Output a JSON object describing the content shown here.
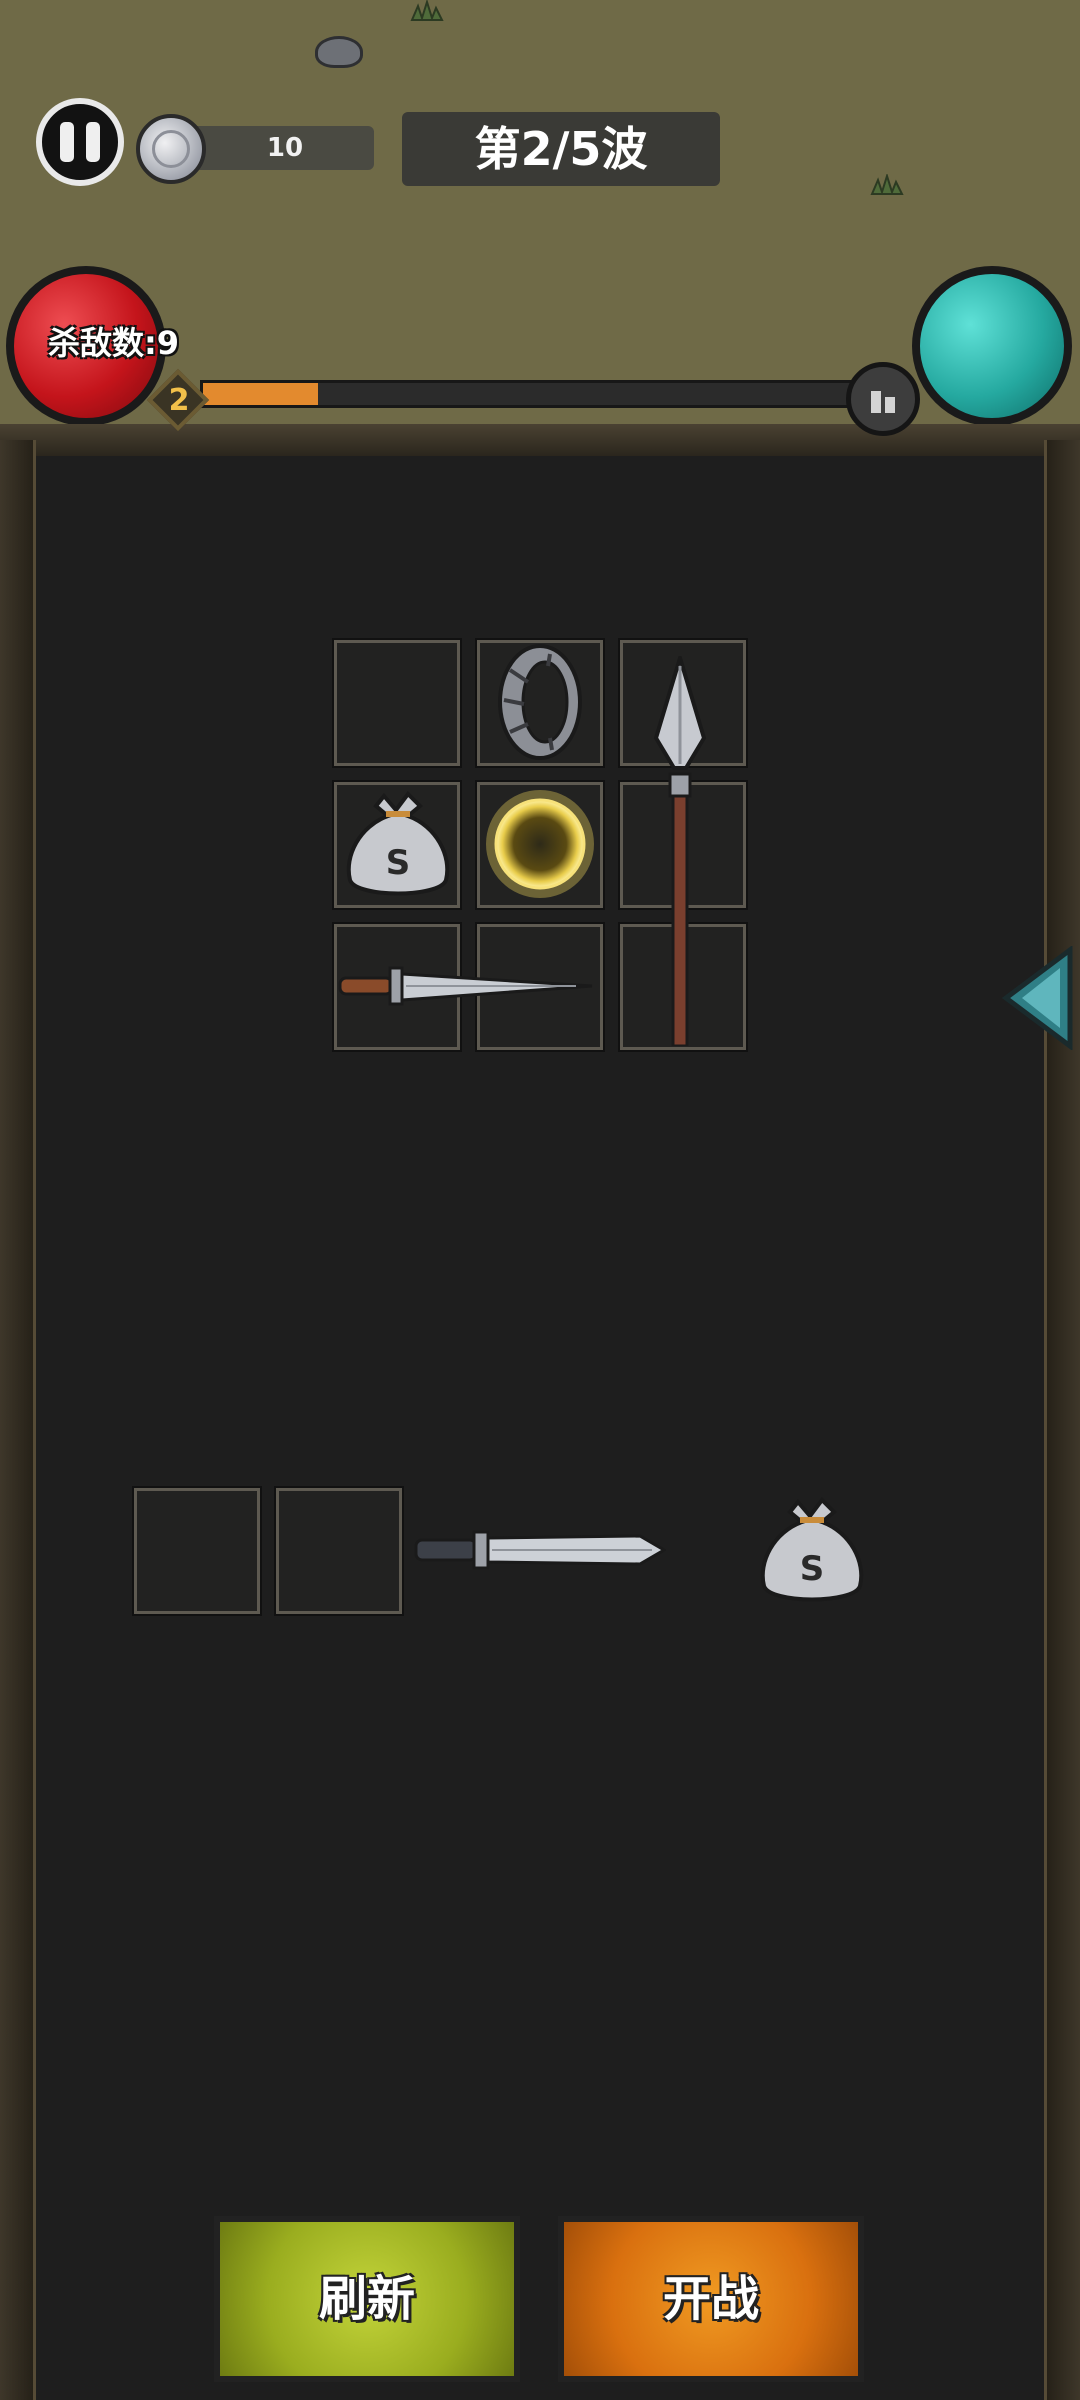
{
  "hud": {
    "coins": "10",
    "wave": "第2/5波",
    "kills": "杀敌数:9",
    "level": "2",
    "xp_progress": 0.17
  },
  "board": {
    "grid_items": [
      {
        "slot": "r1c2",
        "icon": "ring-icon"
      },
      {
        "slot": "r1c3-r3c3",
        "icon": "spear-icon"
      },
      {
        "slot": "r2c1",
        "icon": "money-bag-icon"
      },
      {
        "slot": "r2c2",
        "icon": "golden-orb-icon"
      },
      {
        "slot": "r3c1-r3c2",
        "icon": "dagger-icon"
      }
    ],
    "shop_items": [
      {
        "icon": "sword-icon"
      },
      {
        "icon": "money-bag-icon"
      }
    ]
  },
  "buttons": {
    "refresh": "刷新",
    "fight": "开战"
  },
  "colors": {
    "ground": "#6f6a47",
    "board": "#1e1e1e",
    "xp_fill": "#e38a2e",
    "refresh": "#9aad1f",
    "fight": "#d9700f"
  }
}
